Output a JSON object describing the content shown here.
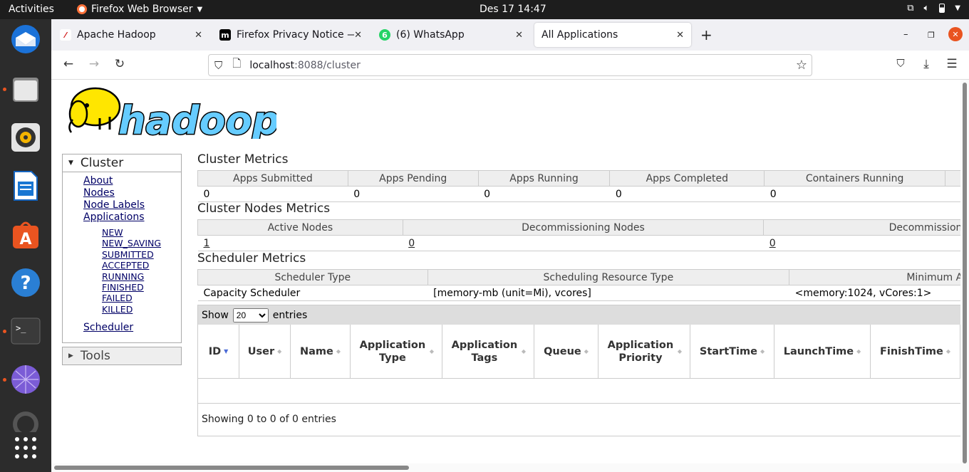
{
  "topbar": {
    "activities": "Activities",
    "app_name": "Firefox Web Browser",
    "clock": "Des 17  14:47",
    "tray_icons": [
      "network-icon",
      "volume-icon",
      "battery-icon",
      "power-icon"
    ]
  },
  "dock": {
    "items": [
      "thunderbird-icon",
      "files-icon",
      "rhythmbox-icon",
      "libreoffice-writer-icon",
      "app-center-icon",
      "help-icon",
      "terminal-icon",
      "web-icon",
      "app-grid-icon"
    ]
  },
  "tabs": [
    {
      "title": "Apache Hadoop",
      "favicon": "hadoop-favicon"
    },
    {
      "title": "Firefox Privacy Notice —",
      "favicon": "mozilla-favicon"
    },
    {
      "title": "(6) WhatsApp",
      "favicon": "whatsapp-favicon",
      "badge": "6"
    },
    {
      "title": "All Applications",
      "favicon": "none"
    }
  ],
  "urlbar": {
    "host": "localhost",
    "path": ":8088/cluster"
  },
  "sidebar": {
    "cluster": "Cluster",
    "links": [
      "About",
      "Nodes",
      "Node Labels",
      "Applications"
    ],
    "states": [
      "NEW",
      "NEW_SAVING",
      "SUBMITTED",
      "ACCEPTED",
      "RUNNING",
      "FINISHED",
      "FAILED",
      "KILLED"
    ],
    "scheduler": "Scheduler",
    "tools": "Tools"
  },
  "cluster_metrics": {
    "title": "Cluster Metrics",
    "headers": [
      "Apps Submitted",
      "Apps Pending",
      "Apps Running",
      "Apps Completed",
      "Containers Running"
    ],
    "values": [
      "0",
      "0",
      "0",
      "0",
      "0",
      "<"
    ]
  },
  "nodes_metrics": {
    "title": "Cluster Nodes Metrics",
    "headers": [
      "Active Nodes",
      "Decommissioning Nodes",
      "Decommissione"
    ],
    "values": [
      "1",
      "0",
      "0"
    ]
  },
  "scheduler_metrics": {
    "title": "Scheduler Metrics",
    "headers": [
      "Scheduler Type",
      "Scheduling Resource Type",
      "Minimum All"
    ],
    "values": [
      "Capacity Scheduler",
      "[memory-mb (unit=Mi), vcores]",
      "<memory:1024, vCores:1>"
    ]
  },
  "apps_table": {
    "show": "Show",
    "entries_value": "20",
    "entries": "entries",
    "columns": [
      "ID",
      "User",
      "Name",
      "Application Type",
      "Application Tags",
      "Queue",
      "Application Priority",
      "StartTime",
      "LaunchTime",
      "FinishTime"
    ],
    "info": "Showing 0 to 0 of 0 entries"
  }
}
